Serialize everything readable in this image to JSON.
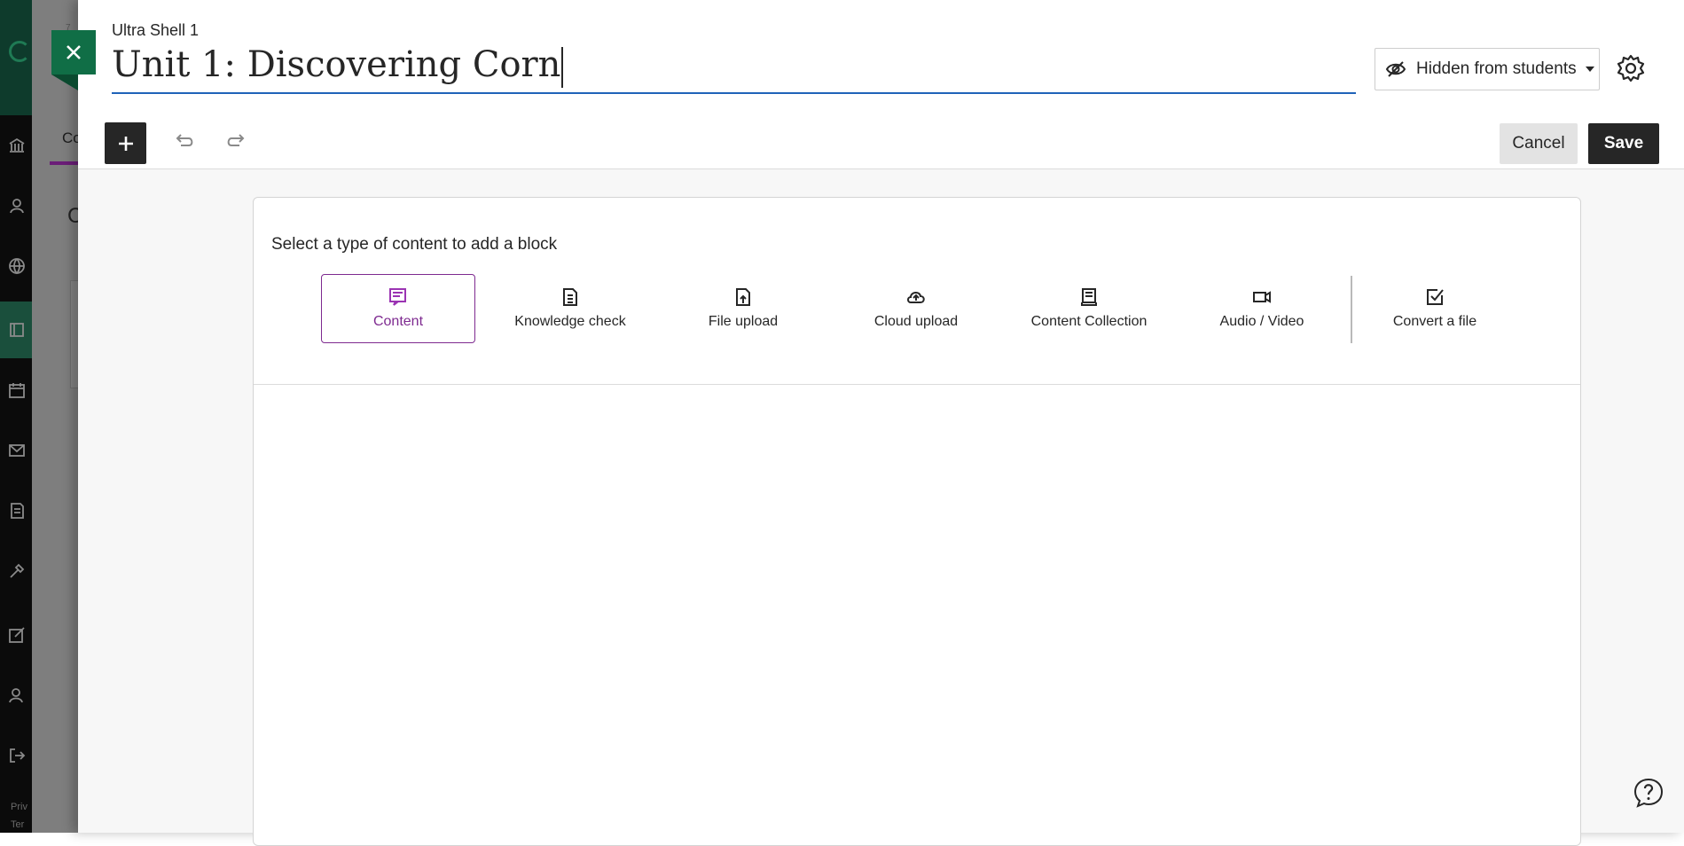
{
  "background": {
    "tab_label": "Co",
    "header_letter": "C",
    "corner_text": "7",
    "footer_lines": [
      "Priv",
      "Ter"
    ],
    "nav_icons": [
      "institution-icon",
      "profile-icon",
      "globe-icon",
      "courses-icon",
      "calendar-icon",
      "messages-icon",
      "grades-icon",
      "tools-icon",
      "assessment-icon",
      "user-icon",
      "signout-icon"
    ]
  },
  "panel": {
    "course_name": "Ultra Shell 1",
    "title_value": "Unit 1: Discovering Corn",
    "visibility": {
      "label": "Hidden from students",
      "icon": "eye-slash-icon"
    },
    "settings_icon": "gear-icon"
  },
  "toolbar": {
    "add_icon": "plus-icon",
    "undo_icon": "undo-icon",
    "redo_icon": "redo-icon",
    "cancel_label": "Cancel",
    "save_label": "Save"
  },
  "content": {
    "prompt": "Select a type of content to add a block",
    "block_types": [
      {
        "label": "Content",
        "icon": "text-block-icon",
        "selected": true
      },
      {
        "label": "Knowledge check",
        "icon": "document-list-icon",
        "selected": false
      },
      {
        "label": "File upload",
        "icon": "file-upload-icon",
        "selected": false
      },
      {
        "label": "Cloud upload",
        "icon": "cloud-upload-icon",
        "selected": false
      },
      {
        "label": "Content Collection",
        "icon": "collection-icon",
        "selected": false
      },
      {
        "label": "Audio / Video",
        "icon": "video-camera-icon",
        "selected": false
      },
      {
        "label": "Convert a file",
        "icon": "checkbox-edit-icon",
        "selected": false
      }
    ]
  },
  "help": {
    "icon": "help-icon"
  },
  "colors": {
    "accent_green": "#106e46",
    "accent_purple": "#7e2a90",
    "input_underline": "#1f63b8",
    "dark_button": "#262626"
  }
}
